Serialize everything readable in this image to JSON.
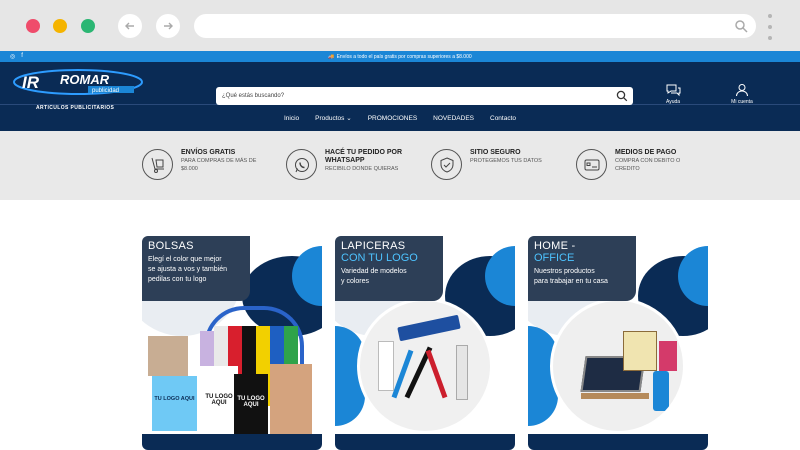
{
  "browser": {
    "address_value": ""
  },
  "topbar": {
    "promo": "Envíos a todo el país gratis por compras superiores a $8.000"
  },
  "header": {
    "logo_text": "ROMAR",
    "logo_sub": "publicidad",
    "tagline": "ARTICULOS PUBLICITARIOS",
    "search_placeholder": "¿Qué estás buscando?",
    "help_label": "Ayuda",
    "account_label": "Mi cuenta"
  },
  "nav": {
    "items": [
      "Inicio",
      "Productos",
      "PROMOCIONES",
      "NOVEDADES",
      "Contacto"
    ]
  },
  "features": [
    {
      "title": "ENVÍOS GRATIS",
      "sub1": "PARA COMPRAS DE MÁS DE",
      "sub2": "$8.000",
      "icon": "hand-truck-icon"
    },
    {
      "title": "HACÉ TU PEDIDO POR",
      "title2": "WHATSAPP",
      "sub1": "RECIBILO DONDE QUIERAS",
      "icon": "whatsapp-icon"
    },
    {
      "title": "SITIO SEGURO",
      "sub1": "PROTEGEMOS TUS DATOS",
      "icon": "shield-check-icon"
    },
    {
      "title": "MEDIOS DE PAGO",
      "sub1": "COMPRA CON DEBITO O",
      "sub2": "CREDITO",
      "icon": "credit-card-icon"
    }
  ],
  "cards": [
    {
      "title": "BOLSAS",
      "desc1": "Elegí el color que mejor",
      "desc2": "se ajusta a vos y también",
      "desc3": "pedilas con tu logo",
      "bag1": "TU LOGO AQUI",
      "bag2": "TU LOGO AQUI",
      "bag3": "TU LOGO AQUI"
    },
    {
      "title": "LAPICERAS",
      "title2": "CON TU LOGO",
      "desc1": "Variedad de modelos",
      "desc2": "y colores"
    },
    {
      "title": "HOME -",
      "title2": "OFFICE",
      "desc1": "Nuestros productos",
      "desc2": "para trabajar en tu casa"
    }
  ],
  "colors": {
    "primary": "#0a2b55",
    "accent": "#1b86d6",
    "light_blue": "#4dc3ff"
  }
}
